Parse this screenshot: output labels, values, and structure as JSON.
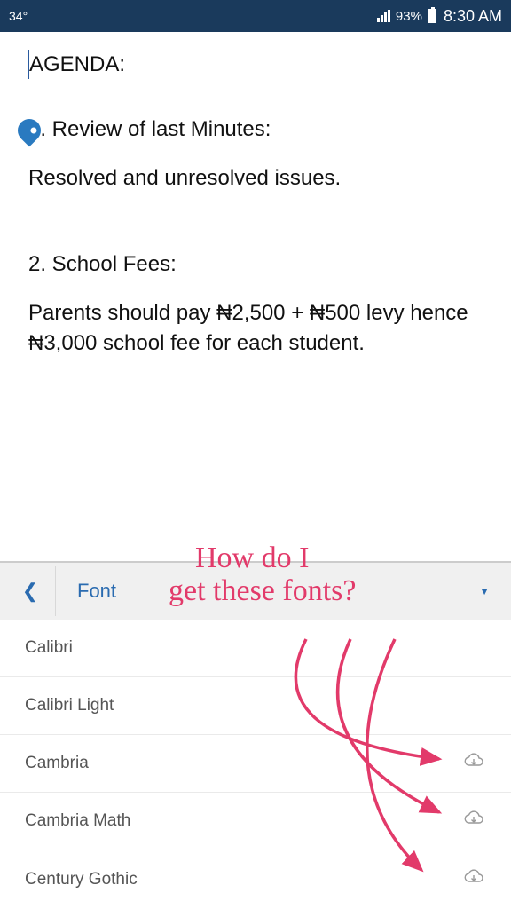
{
  "status": {
    "temp": "34°",
    "battery_pct": "93%",
    "time": "8:30 AM"
  },
  "document": {
    "title": "AGENDA:",
    "item1_heading": "1. Review of last Minutes:",
    "item1_body": "Resolved and unresolved issues.",
    "item2_heading": "2. School Fees:",
    "item2_body": "Parents should pay ₦2,500 + ₦500 levy hence ₦3,000 school fee for each student."
  },
  "font_panel": {
    "title": "Font",
    "items": [
      {
        "name": "Calibri",
        "cloud": false
      },
      {
        "name": "Calibri Light",
        "cloud": false
      },
      {
        "name": "Cambria",
        "cloud": true
      },
      {
        "name": "Cambria Math",
        "cloud": true
      },
      {
        "name": "Century Gothic",
        "cloud": true
      }
    ]
  },
  "annotation": {
    "line1": "How do I",
    "line2": "get these fonts?"
  }
}
